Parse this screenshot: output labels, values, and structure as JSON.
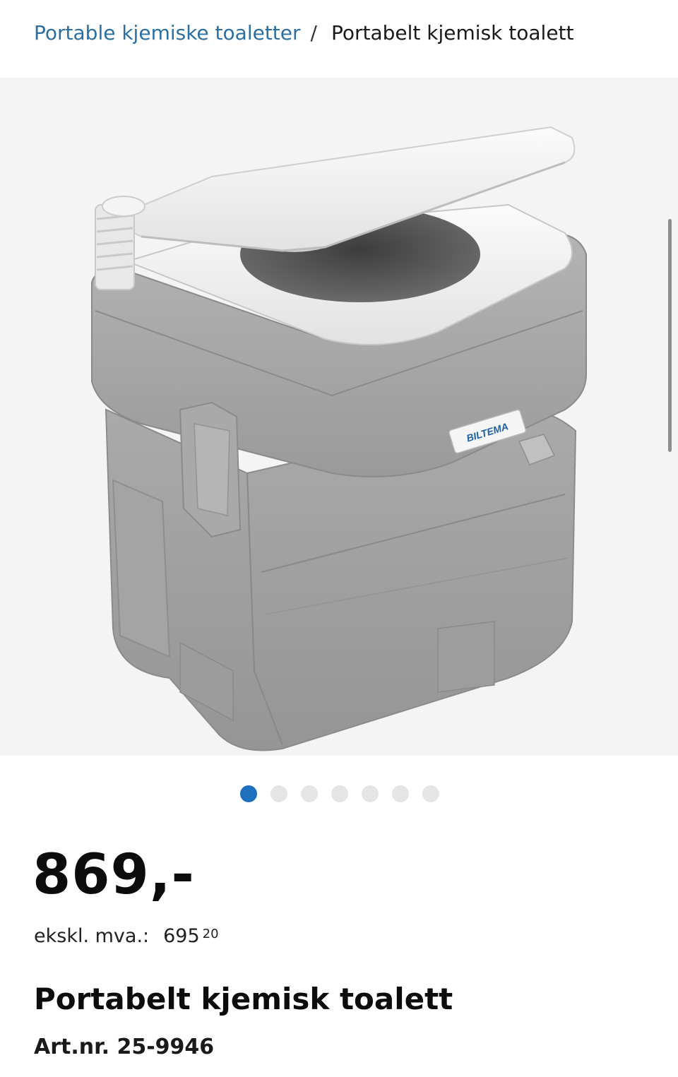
{
  "breadcrumb": {
    "parent_label": "Portable kjemiske toaletter",
    "separator": "/",
    "current_label": "Portabelt kjemisk toalett"
  },
  "gallery": {
    "image_brand_text": "BILTEMA",
    "image_count": 7,
    "active_index": 0
  },
  "pricing": {
    "price": "869,-",
    "vat_label": "ekskl. mva.:",
    "vat_whole": "695",
    "vat_cents": "20"
  },
  "product": {
    "title": "Portabelt kjemisk toalett",
    "art_nr": "Art.nr. 25-9946"
  },
  "colors": {
    "accent": "#1f6fbf",
    "link": "#2c6fa3",
    "image_background": "#f4f4f4"
  }
}
